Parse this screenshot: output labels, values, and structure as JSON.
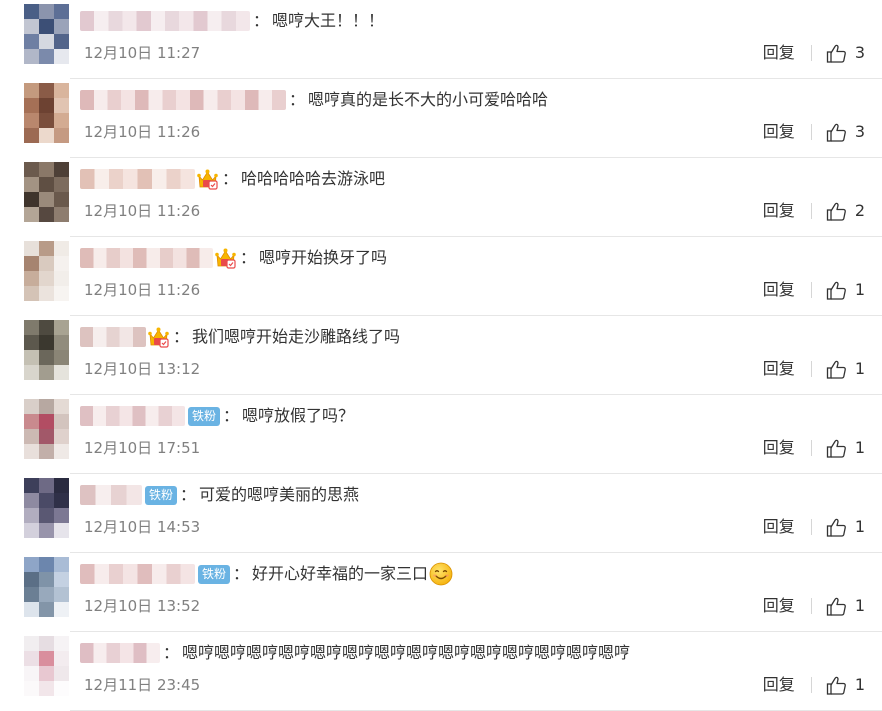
{
  "reply_label": "回复",
  "colon": "：",
  "comments": [
    {
      "text": "嗯哼大王！！！",
      "time": "12月10日 11:27",
      "likes": "3",
      "badge": "",
      "crown": false,
      "smile": false,
      "avatar_colors": [
        "#4a5f86",
        "#8b94ad",
        "#5d6f96",
        "#c2c6d2",
        "#3c4f76",
        "#9aa3b9",
        "#6e7fa3",
        "#d5d8e0",
        "#52648a",
        "#b1b7c8",
        "#7b8aab",
        "#e6e8ee"
      ]
    },
    {
      "text": "嗯哼真的是长不大的小可爱哈哈哈",
      "time": "12月10日 11:26",
      "likes": "3",
      "badge": "",
      "crown": false,
      "smile": false,
      "avatar_colors": [
        "#c49a7e",
        "#8a5b47",
        "#d9b59d",
        "#a57056",
        "#6d4232",
        "#e1c4b2",
        "#b9876d",
        "#7a4e3c",
        "#d3ab92",
        "#9c6a53",
        "#ecd9cc",
        "#c59a82"
      ]
    },
    {
      "text": "哈哈哈哈哈去游泳吧",
      "time": "12月10日 11:26",
      "likes": "2",
      "badge": "",
      "crown": true,
      "smile": false,
      "avatar_colors": [
        "#6b5a4d",
        "#8a7868",
        "#4e4037",
        "#a39383",
        "#5f4f43",
        "#7d6c5e",
        "#3f342c",
        "#9a8a7b",
        "#6a594c",
        "#b3a596",
        "#564840",
        "#8e7d6f"
      ]
    },
    {
      "text": "嗯哼开始换牙了吗",
      "time": "12月10日 11:26",
      "likes": "1",
      "badge": "",
      "crown": true,
      "smile": false,
      "avatar_colors": [
        "#e7e0da",
        "#b89b88",
        "#f0ebe6",
        "#a68470",
        "#d9cabf",
        "#f5f1ee",
        "#c7ad9b",
        "#e2d6cd",
        "#f2eeea",
        "#d4c3b6",
        "#ebe3dd",
        "#f7f4f1"
      ]
    },
    {
      "text": "我们嗯哼开始走沙雕路线了吗",
      "time": "12月10日 13:12",
      "likes": "1",
      "badge": "",
      "crown": true,
      "smile": false,
      "avatar_colors": [
        "#7f7a6c",
        "#4e4a40",
        "#a8a392",
        "#5c584d",
        "#3b382f",
        "#918c7d",
        "#c4c0b3",
        "#6b675b",
        "#8a8576",
        "#d8d5cc",
        "#a29d8f",
        "#e5e3dc"
      ]
    },
    {
      "text": "嗯哼放假了吗？",
      "time": "12月10日 17:51",
      "likes": "1",
      "badge": "铁粉",
      "crown": false,
      "smile": false,
      "avatar_colors": [
        "#d9cfc9",
        "#b7a8a1",
        "#e4dad4",
        "#c98a8e",
        "#b24d63",
        "#d3c4be",
        "#ccb9b3",
        "#a25869",
        "#dfd1cc",
        "#e8dfdb",
        "#c2afa9",
        "#efe9e6"
      ]
    },
    {
      "text": "可爱的嗯哼美丽的思燕",
      "time": "12月10日 14:53",
      "likes": "1",
      "badge": "铁粉",
      "crown": false,
      "smile": false,
      "avatar_colors": [
        "#3d3f5a",
        "#6e6a85",
        "#2a2b40",
        "#8e8aa1",
        "#4a4a66",
        "#2f3048",
        "#b1adbf",
        "#5a5873",
        "#7c7893",
        "#d3d0dc",
        "#9894ab",
        "#e6e4eb"
      ]
    },
    {
      "text": "好开心好幸福的一家三口",
      "time": "12月10日 13:52",
      "likes": "1",
      "badge": "铁粉",
      "crown": false,
      "smile": true,
      "avatar_colors": [
        "#8ea5c7",
        "#6c86ad",
        "#a9bcd6",
        "#5b6f86",
        "#7f93a8",
        "#c4d1e2",
        "#6b7f94",
        "#98a9bc",
        "#b3c2d3",
        "#dde4ec",
        "#8395a8",
        "#eef1f5"
      ]
    },
    {
      "text": "嗯哼嗯哼嗯哼嗯哼嗯哼嗯哼嗯哼嗯哼嗯哼嗯哼嗯哼嗯哼嗯哼嗯哼",
      "time": "12月11日 23:45",
      "likes": "1",
      "badge": "",
      "crown": false,
      "smile": false,
      "avatar_colors": [
        "#f1eef0",
        "#e6dde2",
        "#f6f3f5",
        "#ecdfe5",
        "#d98e9d",
        "#f3ecef",
        "#f8f5f7",
        "#e8c8d1",
        "#efe8eb",
        "#fbf9fa",
        "#f2e6ea",
        "#fdfcfd"
      ]
    }
  ]
}
